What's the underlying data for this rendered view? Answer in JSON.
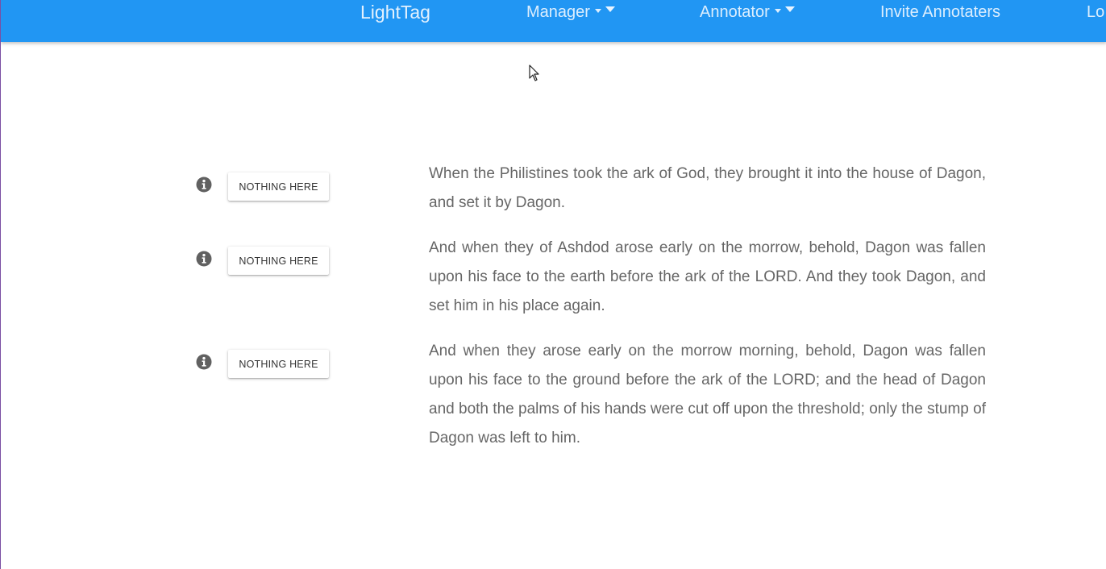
{
  "navbar": {
    "brand": "LightTag",
    "manager_label": "Manager",
    "annotator_label": "Annotator",
    "invite_label": "Invite Annotaters",
    "logout_label": "Lo",
    "background": "#2196f3"
  },
  "rows": [
    {
      "button_label": "NOTHING HERE",
      "text": "When the Philistines took the ark of God, they brought it into the house of Dagon, and set it by Dagon."
    },
    {
      "button_label": "NOTHING HERE",
      "text": "And when they of Ashdod arose early on the morrow, behold, Dagon was fallen upon his face to the earth before the ark of the LORD. And they took Dagon, and set him in his place again."
    },
    {
      "button_label": "NOTHING HERE",
      "text": "And when they arose early on the morrow morning, behold, Dagon was fallen upon his face to the ground before the ark of the LORD; and the head of Dagon and both the palms of his hands were cut off upon the threshold; only the stump of Dagon was left to him."
    }
  ],
  "icons": {
    "info": "info-circle-icon",
    "dropdown": "caret-down-icon",
    "pointer": "mouse-pointer-icon"
  }
}
